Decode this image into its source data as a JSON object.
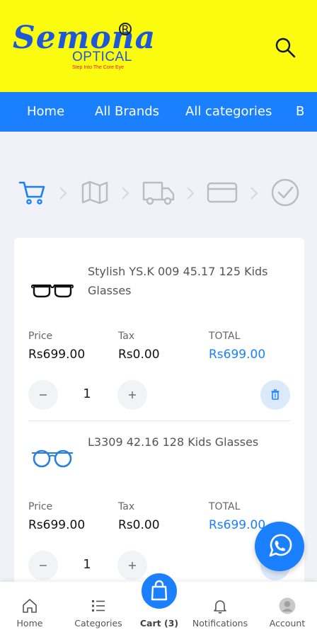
{
  "header": {
    "brand": "Semona",
    "brand_sub": "OPTICAL",
    "tagline": "Step Into The Core Eye",
    "reg_mark": "R"
  },
  "nav": {
    "items": [
      "Home",
      "All Brands",
      "All categories",
      "B"
    ]
  },
  "checkout_steps": [
    "cart-icon",
    "map-icon",
    "truck-icon",
    "credit-card-icon",
    "check-circle-icon"
  ],
  "cart_items": [
    {
      "name": "Stylish YS.K 009 45.17 125 Kids Glasses",
      "price_label": "Price",
      "price": "Rs699.00",
      "tax_label": "Tax",
      "tax": "Rs0.00",
      "total_label": "TOTAL",
      "total": "Rs699.00",
      "quantity": "1",
      "frame_color": "#111111"
    },
    {
      "name": "L3309 42.16 128 Kids Glasses",
      "price_label": "Price",
      "price": "Rs699.00",
      "tax_label": "Tax",
      "tax": "Rs0.00",
      "total_label": "TOTAL",
      "total": "Rs699.00",
      "quantity": "1",
      "frame_color": "#2a7fd9"
    }
  ],
  "bottom_nav": {
    "home": "Home",
    "categories": "Categories",
    "cart": "Cart (3)",
    "notifications": "Notifications",
    "account": "Account"
  },
  "colors": {
    "header_bg": "#fbfb0f",
    "accent": "#1a80ff",
    "brand_blue": "#1e57d8"
  }
}
